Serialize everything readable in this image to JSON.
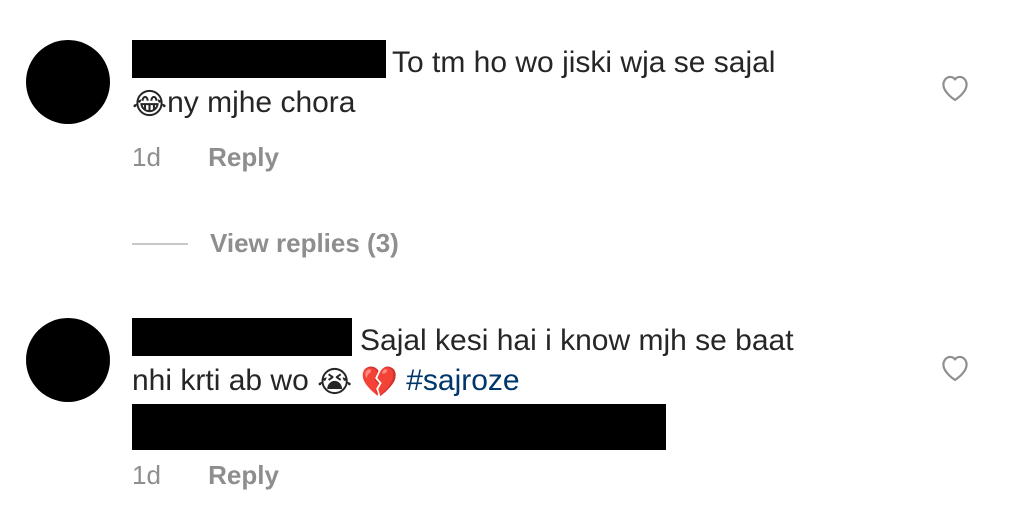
{
  "comments": [
    {
      "text_line1": "To tm ho wo jiski wja se sajal",
      "emoji1": "😂",
      "text_line2": "ny mjhe chora",
      "time": "1d",
      "reply_label": "Reply",
      "icons": {
        "avatar": "avatar",
        "like": "heart-outline-icon"
      }
    },
    {
      "text_line1": "Sajal kesi hai i know mjh se baat",
      "text_line2_prefix": "nhi krti ab wo",
      "emoji1": "😭",
      "emoji2": "💔",
      "hashtag": "#sajroze",
      "time": "1d",
      "reply_label": "Reply",
      "icons": {
        "avatar": "avatar",
        "like": "heart-outline-icon"
      }
    }
  ],
  "view_replies_label": "View replies (3)",
  "colors": {
    "text": "#262626",
    "meta": "#8e8e8e",
    "hashtag": "#00376b",
    "redaction": "#000000"
  }
}
